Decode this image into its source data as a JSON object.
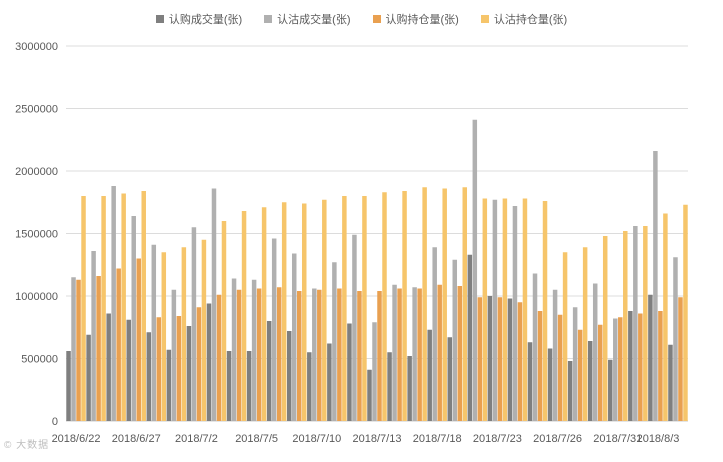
{
  "chart_data": {
    "type": "bar",
    "title": "",
    "xlabel": "",
    "ylabel": "",
    "ylim": [
      0,
      3000000
    ],
    "yticks": [
      0,
      500000,
      1000000,
      1500000,
      2000000,
      2500000,
      3000000
    ],
    "ytick_labels": [
      "0",
      "500000",
      "1000000",
      "1500000",
      "2000000",
      "2500000",
      "3000000"
    ],
    "grid": true,
    "legend_position": "top",
    "x_tick_labels": [
      {
        "index": 0,
        "label": "2018/6/22"
      },
      {
        "index": 3,
        "label": "2018/6/27"
      },
      {
        "index": 6,
        "label": "2018/7/2"
      },
      {
        "index": 9,
        "label": "2018/7/5"
      },
      {
        "index": 12,
        "label": "2018/7/10"
      },
      {
        "index": 15,
        "label": "2018/7/13"
      },
      {
        "index": 18,
        "label": "2018/7/18"
      },
      {
        "index": 21,
        "label": "2018/7/23"
      },
      {
        "index": 24,
        "label": "2018/7/26"
      },
      {
        "index": 27,
        "label": "2018/7/31"
      },
      {
        "index": 30,
        "label": "2018/8/3"
      }
    ],
    "categories": [
      "2018/6/22",
      "2018/6/25",
      "2018/6/26",
      "2018/6/27",
      "2018/6/28",
      "2018/6/29",
      "2018/7/2",
      "2018/7/3",
      "2018/7/4",
      "2018/7/5",
      "2018/7/6",
      "2018/7/9",
      "2018/7/10",
      "2018/7/11",
      "2018/7/12",
      "2018/7/13",
      "2018/7/16",
      "2018/7/17",
      "2018/7/18",
      "2018/7/19",
      "2018/7/20",
      "2018/7/23",
      "2018/7/24",
      "2018/7/25",
      "2018/7/26",
      "2018/7/27",
      "2018/7/30",
      "2018/7/31",
      "2018/8/1",
      "2018/8/2",
      "2018/8/3"
    ],
    "series": [
      {
        "name": "认购成交量(张)",
        "color": "#7f7f7f",
        "values": [
          560000,
          690000,
          860000,
          810000,
          710000,
          570000,
          760000,
          940000,
          560000,
          560000,
          800000,
          720000,
          550000,
          620000,
          780000,
          410000,
          550000,
          520000,
          730000,
          670000,
          1330000,
          1000000,
          980000,
          630000,
          580000,
          480000,
          640000,
          490000,
          880000,
          1010000,
          610000
        ]
      },
      {
        "name": "认沽成交量(张)",
        "color": "#b0b0b0",
        "values": [
          1150000,
          1360000,
          1880000,
          1640000,
          1410000,
          1050000,
          1550000,
          1860000,
          1140000,
          1130000,
          1460000,
          1340000,
          1060000,
          1270000,
          1490000,
          790000,
          1090000,
          1070000,
          1390000,
          1290000,
          2410000,
          1770000,
          1720000,
          1180000,
          1050000,
          910000,
          1100000,
          820000,
          1560000,
          2160000,
          1310000
        ]
      },
      {
        "name": "认购持仓量(张)",
        "color": "#e9a050",
        "values": [
          1130000,
          1160000,
          1220000,
          1300000,
          830000,
          840000,
          910000,
          1010000,
          1050000,
          1060000,
          1070000,
          1040000,
          1050000,
          1060000,
          1040000,
          1040000,
          1060000,
          1060000,
          1090000,
          1080000,
          990000,
          990000,
          950000,
          880000,
          850000,
          730000,
          770000,
          830000,
          860000,
          880000,
          990000
        ]
      },
      {
        "name": "认沽持仓量(张)",
        "color": "#f6c56b",
        "values": [
          1800000,
          1800000,
          1820000,
          1840000,
          1350000,
          1390000,
          1450000,
          1600000,
          1680000,
          1710000,
          1750000,
          1740000,
          1770000,
          1800000,
          1800000,
          1830000,
          1840000,
          1870000,
          1860000,
          1870000,
          1780000,
          1780000,
          1780000,
          1760000,
          1350000,
          1390000,
          1480000,
          1520000,
          1560000,
          1660000,
          1730000
        ]
      }
    ]
  },
  "watermark": "© 大数据"
}
